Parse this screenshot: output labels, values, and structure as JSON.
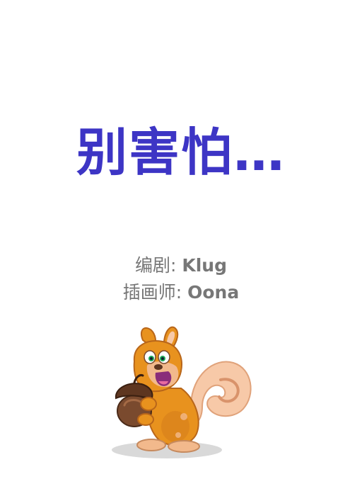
{
  "book": {
    "title": "别害怕…",
    "credits": [
      {
        "role": "编剧: ",
        "name": "Klug"
      },
      {
        "role": "插画师: ",
        "name": "Oona"
      }
    ]
  },
  "illustration": {
    "icon": "squirrel-holding-acorn-icon",
    "colors": {
      "fur": "#e8921e",
      "fur_dark": "#c8701a",
      "tail_light": "#f7c9a8",
      "belly": "#f2b98c",
      "acorn": "#7a4a2e",
      "acorn_cap": "#5e3620",
      "shadow": "#d9d9d9"
    }
  }
}
